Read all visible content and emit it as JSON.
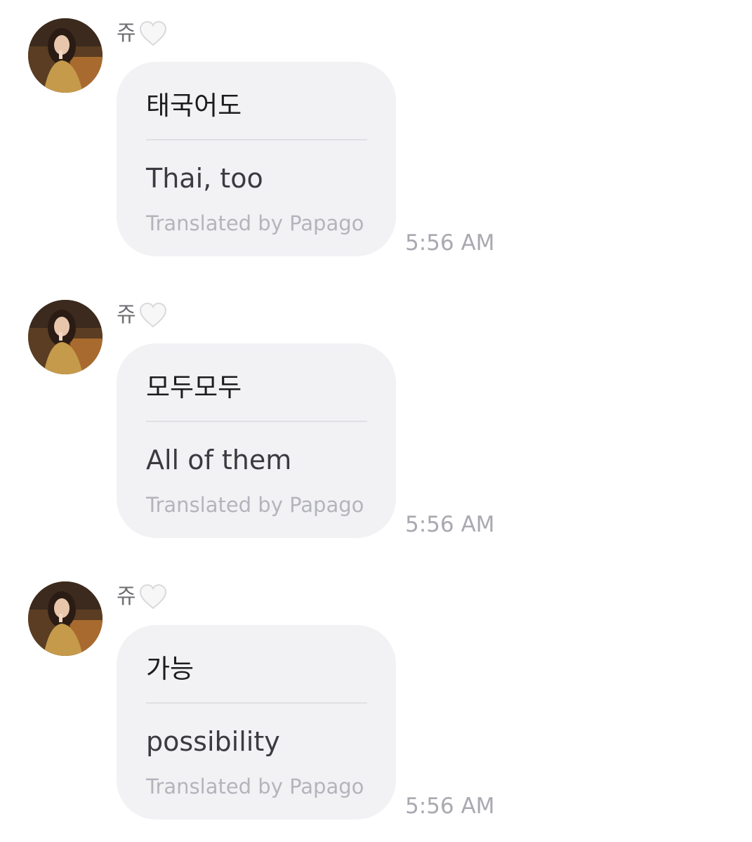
{
  "messages": [
    {
      "sender": "쥬",
      "heart_icon": "white-heart-icon",
      "original": "태국어도",
      "translated": "Thai, too",
      "credit": "Translated by Papago",
      "time": "5:56 AM"
    },
    {
      "sender": "쥬",
      "heart_icon": "white-heart-icon",
      "original": "모두모두",
      "translated": "All of them",
      "credit": "Translated by Papago",
      "time": "5:56 AM"
    },
    {
      "sender": "쥬",
      "heart_icon": "white-heart-icon",
      "original": "가능",
      "translated": "possibility",
      "credit": "Translated by Papago",
      "time": "5:56 AM"
    }
  ],
  "colors": {
    "bubble": "#f2f2f5",
    "heart": "#f7f7f7",
    "timestamp": "#a9a9b0",
    "credit": "#b4b4bc"
  }
}
